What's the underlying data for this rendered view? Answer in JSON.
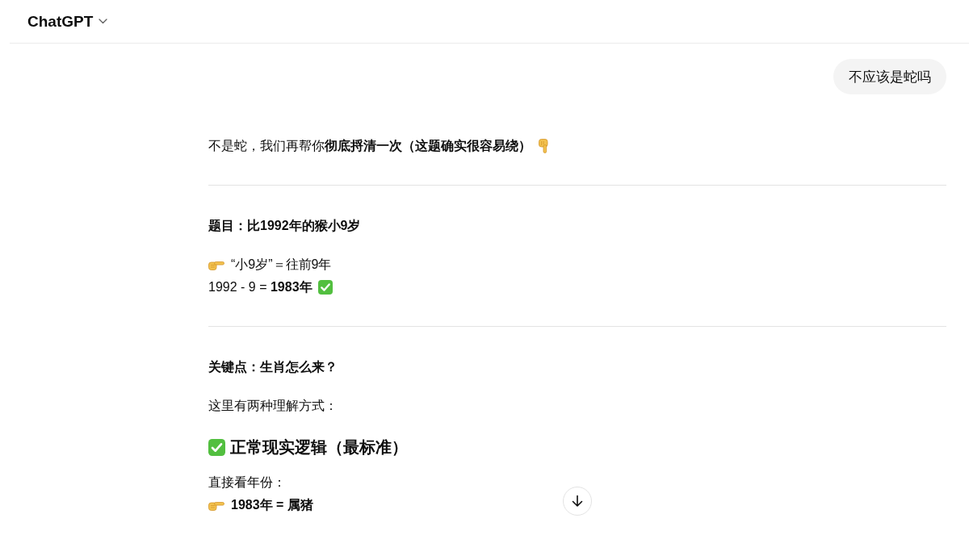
{
  "header": {
    "model_selector": "ChatGPT"
  },
  "conversation": {
    "user_message": "不应该是蛇吗",
    "response": [
      {
        "kind": "paragraph",
        "lines": [
          {
            "kind": "intro",
            "text": "不是蛇，我们再帮你**彻底捋清一次（这题确实很容易绕）**"
          }
        ]
      },
      {
        "kind": "divider"
      },
      {
        "kind": "heading",
        "text": "题目：比1992年的猴小9岁"
      },
      {
        "kind": "paragraph",
        "lines": [
          {
            "kind": "pointer",
            "text": "“小9岁”＝往前9年"
          },
          {
            "kind": "result",
            "text": "1992 - 9 = **1983年**"
          }
        ]
      },
      {
        "kind": "divider"
      },
      {
        "kind": "heading",
        "text": "关键点：生肖怎么来？"
      },
      {
        "kind": "paragraph",
        "lines": [
          {
            "kind": "plain",
            "text": "这里有两种理解方式："
          }
        ]
      },
      {
        "kind": "check-heading",
        "text": "正常现实逻辑（最标准）"
      },
      {
        "kind": "paragraph",
        "lines": [
          {
            "kind": "plain",
            "text": "直接看年份："
          },
          {
            "kind": "pointer-strong",
            "text": "1983年 = 属猪"
          }
        ]
      }
    ]
  }
}
